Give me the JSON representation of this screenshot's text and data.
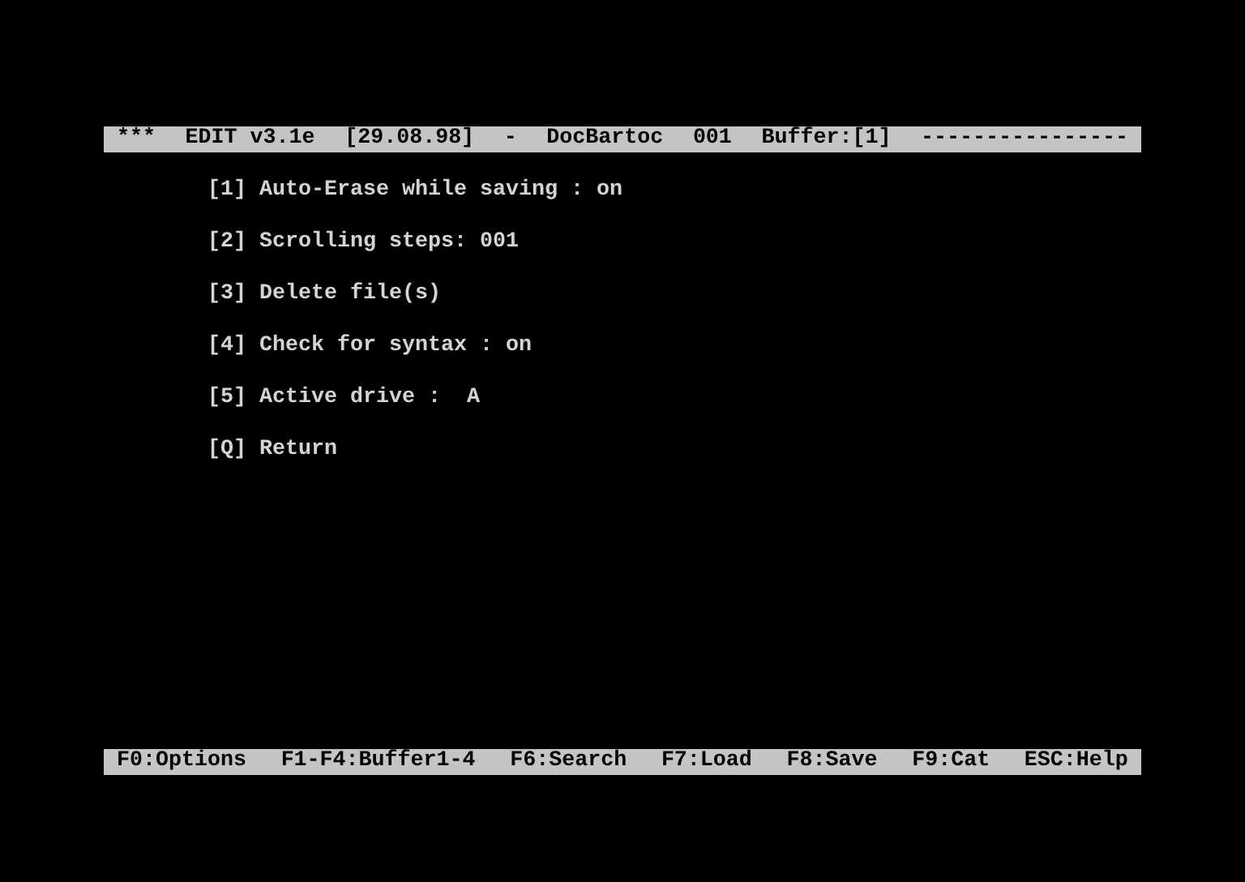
{
  "header": [
    "***",
    "EDIT v3.1e",
    "[29.08.98]",
    "-",
    "DocBartoc",
    "001",
    "Buffer:[1]",
    "----------------"
  ],
  "menu": [
    {
      "key": "[1]",
      "label": "Auto-Erase while saving : on"
    },
    {
      "key": "[2]",
      "label": "Scrolling steps: 001"
    },
    {
      "key": "[3]",
      "label": "Delete file(s)"
    },
    {
      "key": "[4]",
      "label": "Check for syntax : on"
    },
    {
      "key": "[5]",
      "label": "Active drive :  A"
    },
    {
      "key": "[Q]",
      "label": "Return"
    }
  ],
  "function_keys": [
    "F0:Options",
    "F1-F4:Buffer1-4",
    "F6:Search",
    "F7:Load",
    "F8:Save",
    "F9:Cat",
    "ESC:Help"
  ]
}
